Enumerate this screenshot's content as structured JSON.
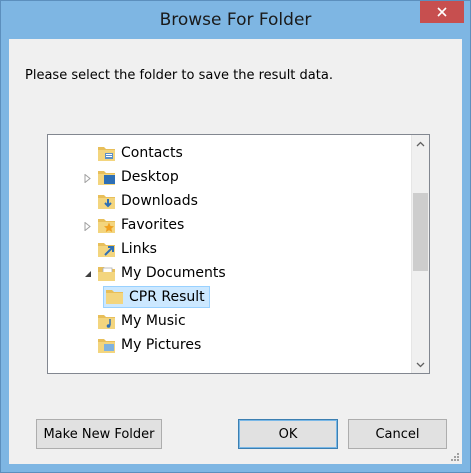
{
  "window": {
    "title": "Browse For Folder"
  },
  "dialog": {
    "prompt": "Please select the folder to save the result data."
  },
  "tree": {
    "items": [
      {
        "label": "Contacts",
        "icon": "contacts-folder-icon",
        "expander": "none"
      },
      {
        "label": "Desktop",
        "icon": "desktop-folder-icon",
        "expander": "collapsed"
      },
      {
        "label": "Downloads",
        "icon": "downloads-folder-icon",
        "expander": "none"
      },
      {
        "label": "Favorites",
        "icon": "favorites-folder-icon",
        "expander": "collapsed"
      },
      {
        "label": "Links",
        "icon": "links-folder-icon",
        "expander": "none"
      },
      {
        "label": "My Documents",
        "icon": "documents-folder-icon",
        "expander": "expanded"
      },
      {
        "label": "CPR Result",
        "icon": "folder-icon",
        "expander": "none",
        "selected": true
      },
      {
        "label": "My Music",
        "icon": "music-folder-icon",
        "expander": "none"
      },
      {
        "label": "My Pictures",
        "icon": "pictures-folder-icon",
        "expander": "none"
      }
    ],
    "scroll_position": 0.45
  },
  "buttons": {
    "make_new_folder": "Make New Folder",
    "ok": "OK",
    "cancel": "Cancel"
  },
  "colors": {
    "titlebar": "#7eb6e3",
    "close": "#c74f4f",
    "selection": "#cce8ff",
    "folder": "#e8bf5a"
  }
}
